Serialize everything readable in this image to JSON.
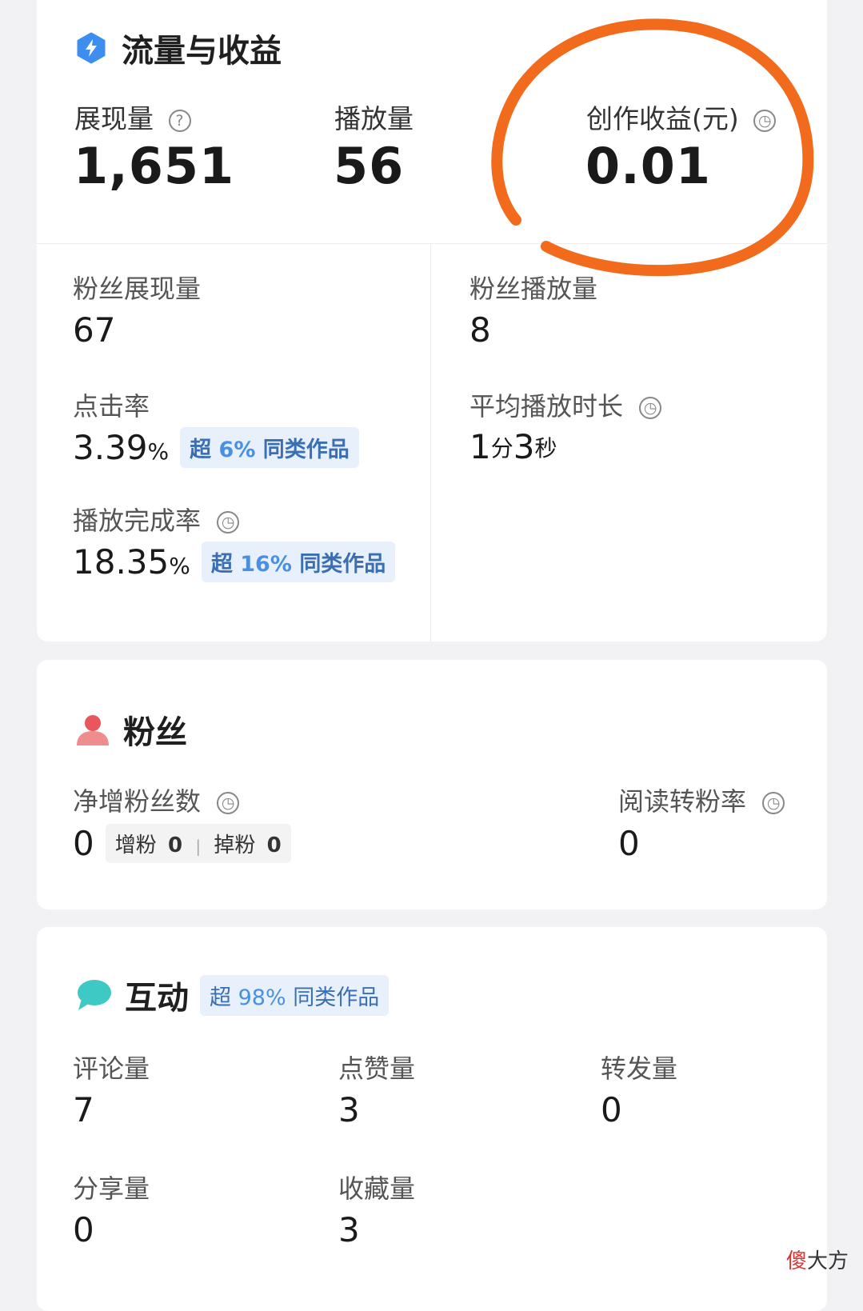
{
  "traffic": {
    "title": "流量与收益",
    "exposure": {
      "label": "展现量",
      "value": "1,651"
    },
    "plays": {
      "label": "播放量",
      "value": "56"
    },
    "earnings": {
      "label": "创作收益(元)",
      "value": "0.01"
    },
    "fan_exposure": {
      "label": "粉丝展现量",
      "value": "67"
    },
    "fan_plays": {
      "label": "粉丝播放量",
      "value": "8"
    },
    "ctr": {
      "label": "点击率",
      "value": "3.39",
      "unit": "%",
      "badge_prefix": "超",
      "badge_value": "6%",
      "badge_suffix": "同类作品"
    },
    "avg_duration": {
      "label": "平均播放时长",
      "min_value": "1",
      "min_unit": "分",
      "sec_value": "3",
      "sec_unit": "秒"
    },
    "completion": {
      "label": "播放完成率",
      "value": "18.35",
      "unit": "%",
      "badge_prefix": "超",
      "badge_value": "16%",
      "badge_suffix": "同类作品"
    }
  },
  "fans": {
    "title": "粉丝",
    "net_growth": {
      "label": "净增粉丝数",
      "value": "0",
      "gain_label": "增粉",
      "gain_value": "0",
      "sep": "|",
      "loss_label": "掉粉",
      "loss_value": "0"
    },
    "read_convert": {
      "label": "阅读转粉率",
      "value": "0"
    }
  },
  "interaction": {
    "title": "互动",
    "badge_prefix": "超",
    "badge_value": "98%",
    "badge_suffix": "同类作品",
    "comments": {
      "label": "评论量",
      "value": "7"
    },
    "likes": {
      "label": "点赞量",
      "value": "3"
    },
    "forwards": {
      "label": "转发量",
      "value": "0"
    },
    "shares": {
      "label": "分享量",
      "value": "0"
    },
    "favorites": {
      "label": "收藏量",
      "value": "3"
    }
  },
  "icons": {
    "traffic": "lightning-icon",
    "fans": "person-icon",
    "interaction": "chat-bubble-icon",
    "question": "question-icon",
    "clock": "clock-icon"
  },
  "colors": {
    "accent_blue": "#3d8ef0",
    "fan_red": "#e9575c",
    "chat_teal": "#3ec9c4",
    "annotation_orange": "#f26b1d"
  },
  "watermark": {
    "first": "傻",
    "rest": "大方"
  }
}
